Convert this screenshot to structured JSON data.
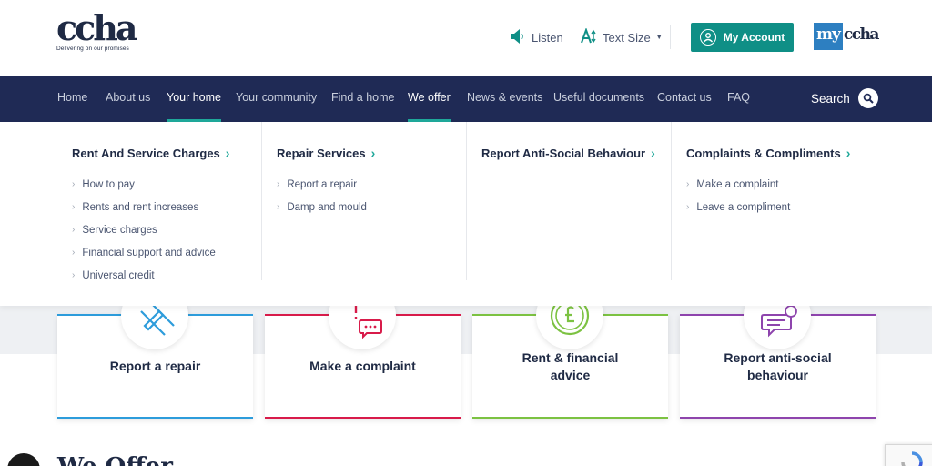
{
  "header": {
    "logo_text": "ccha",
    "logo_tagline": "Delivering on our promises",
    "listen_label": "Listen",
    "text_size_label": "Text Size",
    "my_account_label": "My Account",
    "myccha_my": "my",
    "myccha_ccha": "ccha"
  },
  "nav": {
    "items": [
      {
        "label": "Home",
        "active": false
      },
      {
        "label": "About us",
        "active": false
      },
      {
        "label": "Your home",
        "active": true
      },
      {
        "label": "Your community",
        "active": false
      },
      {
        "label": "Find a home",
        "active": false
      },
      {
        "label": "We offer",
        "active": true
      },
      {
        "label": "News & events",
        "active": false
      },
      {
        "label": "Useful documents",
        "active": false
      },
      {
        "label": "Contact us",
        "active": false
      },
      {
        "label": "FAQ",
        "active": false
      }
    ],
    "search_label": "Search"
  },
  "mega_menu": {
    "columns": [
      {
        "heading": "Rent And Service Charges",
        "links": [
          "How to pay",
          "Rents and rent increases",
          "Service charges",
          "Financial support and advice",
          "Universal credit"
        ]
      },
      {
        "heading": "Repair Services",
        "links": [
          "Report a repair",
          "Damp and mould"
        ]
      },
      {
        "heading": "Report Anti-Social Behaviour",
        "links": []
      },
      {
        "heading": "Complaints & Compliments",
        "links": [
          "Make a complaint",
          "Leave a compliment"
        ]
      }
    ]
  },
  "cards": [
    {
      "label": "Report a repair",
      "icon": "tools-icon",
      "color": "#2d9cdb"
    },
    {
      "label": "Make a complaint",
      "icon": "speech-bubble-icon",
      "color": "#d81b4a"
    },
    {
      "label": "Rent & financial advice",
      "icon": "pound-coin-icon",
      "color": "#7cc242"
    },
    {
      "label": "Report anti-social behaviour",
      "icon": "chat-alert-icon",
      "color": "#8e44ad"
    }
  ],
  "section_heading": "We Offer",
  "colors": {
    "nav_bg": "#1f2a55",
    "accent_teal": "#1fa89a",
    "account_btn": "#0f8f86",
    "brand_navy": "#1f2a44"
  }
}
